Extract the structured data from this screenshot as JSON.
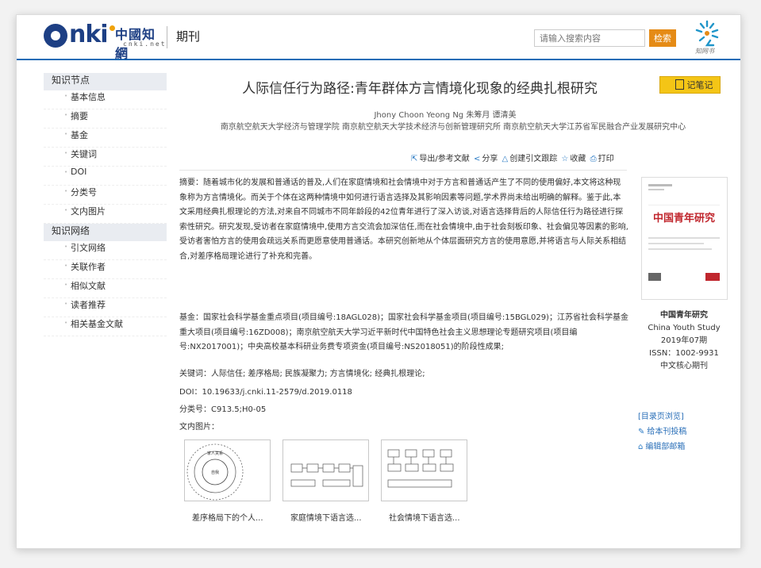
{
  "header": {
    "logo_text": "CNKI",
    "logo_cn": "中國知網",
    "logo_net": "cnki.net",
    "section": "期刊",
    "search_placeholder": "请输入搜索内容",
    "search_button": "检索",
    "brand_text": "知网书"
  },
  "sidebar": {
    "group1": "知识节点",
    "items1": [
      "基本信息",
      "摘要",
      "基金",
      "关键词",
      "DOI",
      "分类号",
      "文内图片"
    ],
    "group2": "知识网络",
    "items2": [
      "引文网络",
      "关联作者",
      "相似文献",
      "读者推荐",
      "相关基金文献"
    ]
  },
  "article": {
    "title": "人际信任行为路径:青年群体方言情境化现象的经典扎根研究",
    "note_button": "记笔记",
    "authors": "Jhony Choon Yeong Ng   朱筹月   谭清美",
    "affiliations": "南京航空航天大学经济与管理学院   南京航空航天大学技术经济与创新管理研究所   南京航空航天大学江苏省军民融合产业发展研究中心",
    "tools": [
      "导出/参考文献",
      "分享",
      "创建引文跟踪",
      "收藏",
      "打印"
    ],
    "abstract": "摘要：随着城市化的发展和普通话的普及,人们在家庭情境和社会情境中对于方言和普通话产生了不同的使用偏好,本文将这种现象称为方言情境化。而关于个体在这两种情境中如何进行语言选择及其影响因素等问题,学术界尚未给出明确的解释。鉴于此,本文采用经典扎根理论的方法,对来自不同城市不同年龄段的42位青年进行了深入访谈,对语言选择背后的人际信任行为路径进行探索性研究。研究发现,受访者在家庭情境中,使用方言交流会加深信任,而在社会情境中,由于社会刻板印象、社会偏见等因素的影响,受访者害怕方言的使用会疏远关系而更愿意使用普通话。本研究创新地从个体层面研究方言的使用意愿,并将语言与人际关系相结合,对差序格局理论进行了补充和完善。",
    "fund": "基金：国家社会科学基金重点项目(项目编号:18AGL028)；国家社会科学基金项目(项目编号:15BGL029)；江苏省社会科学基金重大项目(项目编号:16ZD008)；南京航空航天大学习近平新时代中国特色社会主义思想理论专题研究项目(项目编号:NX2017001)；中央高校基本科研业务费专项资金(项目编号:NS2018051)的阶段性成果;",
    "keywords": "关键词：人际信任; 差序格局; 民族凝聚力; 方言情境化; 经典扎根理论;",
    "doi": "DOI：10.19633/j.cnki.11-2579/d.2019.0118",
    "classification": "分类号：C913.5;H0-05",
    "figures_label": "文内图片：",
    "figures": [
      {
        "caption": "差序格局下的个人...",
        "inner_text": "家人关系",
        "inner_text2": "自我"
      },
      {
        "caption": "家庭情境下语言选..."
      },
      {
        "caption": "社会情境下语言选..."
      }
    ]
  },
  "journal": {
    "cover_title": "中国青年研究",
    "name_cn": "中国青年研究",
    "name_en": "China Youth Study",
    "issue": "2019年07期",
    "issn": "ISSN：1002-9931",
    "core": "中文核心期刊",
    "links": [
      "[目录页浏览]",
      "给本刊投稿",
      "编辑部邮箱"
    ]
  },
  "colors": {
    "brand_blue": "#1d3f84",
    "accent_orange": "#e58b16",
    "note_yellow": "#f4c516",
    "link_blue": "#2a6fb8"
  }
}
